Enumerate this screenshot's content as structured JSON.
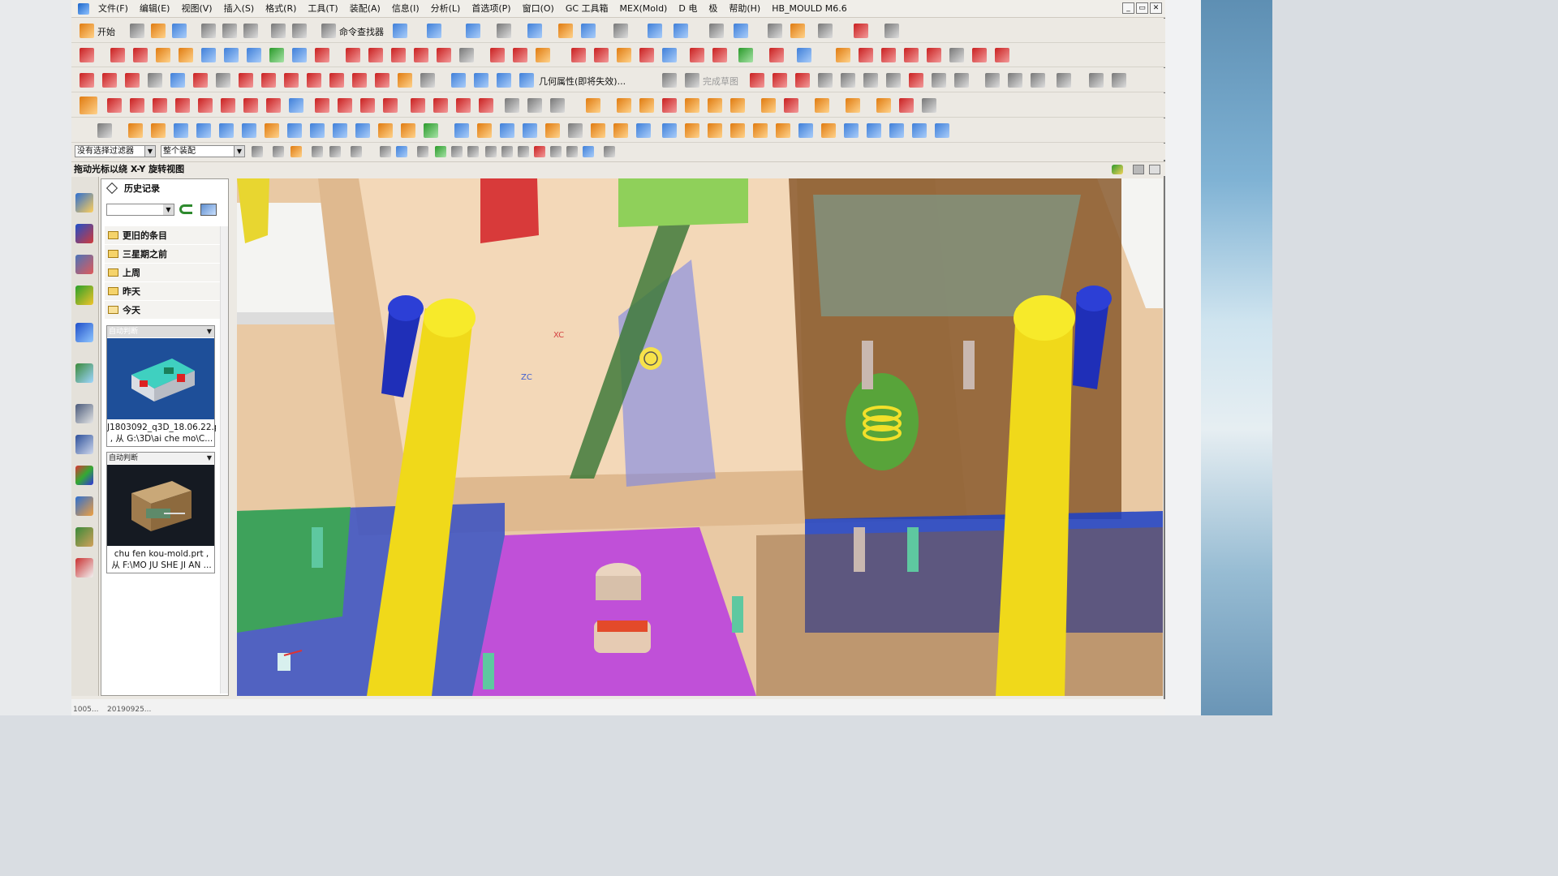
{
  "window": {
    "menus": [
      "文件(F)",
      "编辑(E)",
      "视图(V)",
      "插入(S)",
      "格式(R)",
      "工具(T)",
      "装配(A)",
      "信息(I)",
      "分析(L)",
      "首选项(P)",
      "窗口(O)",
      "GC 工具箱",
      "MEX(Mold)",
      "D 电",
      "极",
      "帮助(H)",
      "HB_MOULD M6.6"
    ],
    "controls": {
      "minimize": "_",
      "restore": "▭",
      "close": "✕"
    }
  },
  "toolbar": {
    "start_label": "开始",
    "command_finder_label": "命令查找器",
    "geometry_property_label": "几何属性(即将失效)...",
    "finish_sketch_label": "完成草图"
  },
  "filterbar": {
    "selection_filter": "没有选择过滤器",
    "assembly_scope": "整个装配"
  },
  "status": {
    "text": "拖动光标以绕 X-Y 旋转视图"
  },
  "history": {
    "title": "历史记录",
    "groups": [
      "更旧的条目",
      "三星期之前",
      "上周",
      "昨天",
      "今天"
    ],
    "cards": [
      {
        "mode": "自动判断",
        "caption1": "J1803092_q3D_18.06.22.p",
        "caption2": ", 从 G:\\3D\\ai che mo\\C..."
      },
      {
        "mode": "自动判断",
        "caption1": "chu fen kou-mold.prt ,",
        "caption2": "从 F:\\MO JU SHE JI AN ..."
      }
    ]
  },
  "viewport": {
    "axis_x": "XC",
    "axis_z": "ZC"
  },
  "taskbar": {
    "item1": "1005...",
    "item2": "20190925..."
  },
  "colors": {
    "pillar": "#f0d91a",
    "bolt": "#1f2fb8",
    "plate_magenta": "#c050d8",
    "plate_blue": "#1a3fc8",
    "plate_green": "#59b83a",
    "mold_brown": "#8a5a2e"
  }
}
